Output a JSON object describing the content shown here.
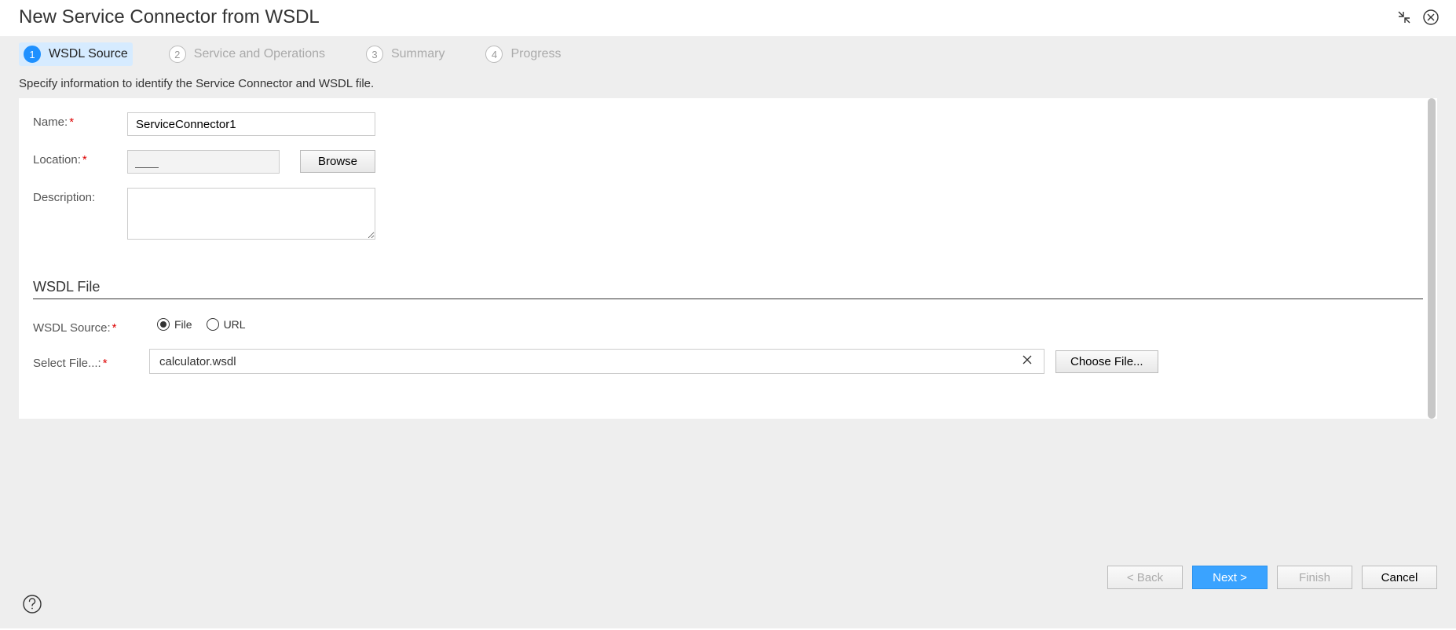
{
  "title": "New Service Connector from WSDL",
  "steps": [
    {
      "num": "1",
      "label": "WSDL Source",
      "active": true
    },
    {
      "num": "2",
      "label": "Service and Operations",
      "active": false
    },
    {
      "num": "3",
      "label": "Summary",
      "active": false
    },
    {
      "num": "4",
      "label": "Progress",
      "active": false
    }
  ],
  "instruction": "Specify information to identify the Service Connector and WSDL file.",
  "form": {
    "name_label": "Name:",
    "name_value": "ServiceConnector1",
    "location_label": "Location:",
    "location_value": "",
    "browse_label": "Browse",
    "description_label": "Description:",
    "description_value": ""
  },
  "wsdl_section": {
    "heading": "WSDL File",
    "source_label": "WSDL Source:",
    "radio_file": "File",
    "radio_url": "URL",
    "selected_radio": "file",
    "select_file_label": "Select File...:",
    "select_file_value": "calculator.wsdl",
    "choose_file_label": "Choose File..."
  },
  "footer": {
    "back": "< Back",
    "next": "Next >",
    "finish": "Finish",
    "cancel": "Cancel"
  }
}
